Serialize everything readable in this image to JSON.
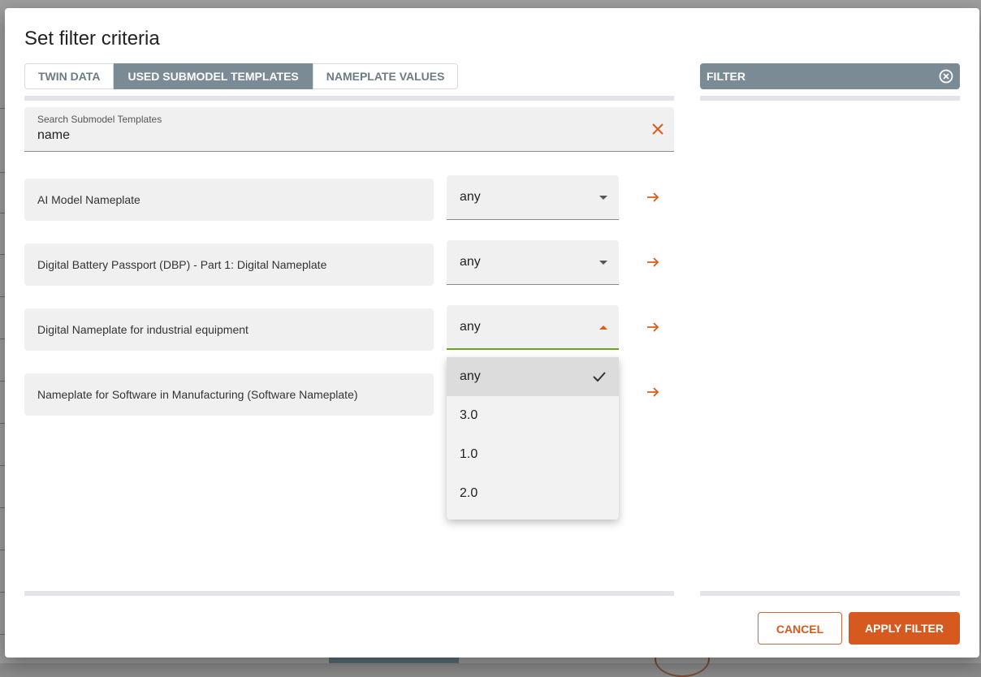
{
  "dialog": {
    "title": "Set filter criteria"
  },
  "tabs": [
    {
      "label": "TWIN DATA",
      "active": false
    },
    {
      "label": "USED SUBMODEL TEMPLATES",
      "active": true
    },
    {
      "label": "NAMEPLATE VALUES",
      "active": false
    }
  ],
  "search": {
    "label": "Search Submodel Templates",
    "value": "name",
    "clear_icon": "close-icon"
  },
  "templates": [
    {
      "name": "AI Model Nameplate",
      "version": "any",
      "open": false
    },
    {
      "name": "Digital Battery Passport (DBP) - Part 1: Digital Nameplate",
      "version": "any",
      "open": false
    },
    {
      "name": "Digital Nameplate for industrial equipment",
      "version": "any",
      "open": true
    },
    {
      "name": "Nameplate for Software in Manufacturing (Software Nameplate)",
      "version": "any",
      "open": false
    }
  ],
  "dropdown": {
    "options": [
      "any",
      "3.0",
      "1.0",
      "2.0"
    ],
    "selected": "any"
  },
  "filter_panel": {
    "title": "FILTER",
    "close_icon": "circle-close-icon"
  },
  "actions": {
    "cancel_label": "CANCEL",
    "apply_label": "APPLY FILTER"
  },
  "colors": {
    "accent": "#d65a1f",
    "tab_active": "#7a8b96",
    "focus_underline": "#6aa121"
  }
}
